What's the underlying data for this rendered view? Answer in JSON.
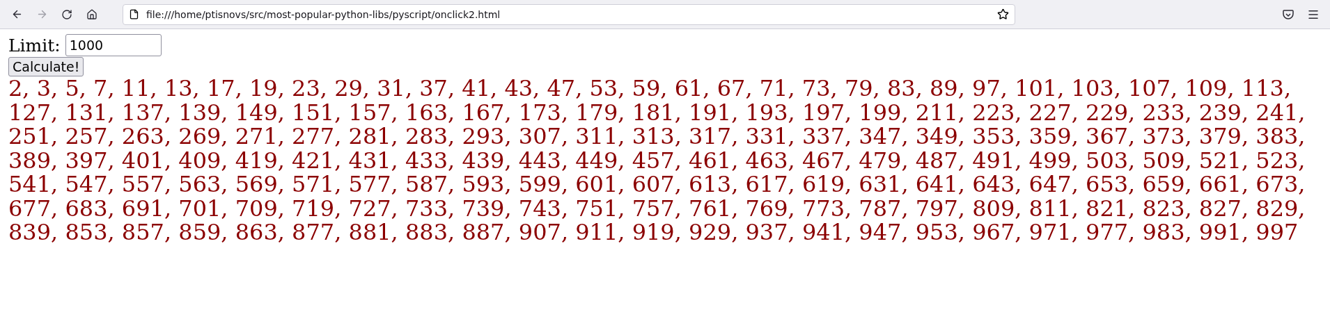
{
  "browser": {
    "back_disabled": false,
    "forward_disabled": true,
    "url": "file:///home/ptisnovs/src/most-popular-python-libs/pyscript/onclick2.html"
  },
  "form": {
    "label": "Limit:",
    "value": "1000",
    "button": "Calculate!"
  },
  "output": "2, 3, 5, 7, 11, 13, 17, 19, 23, 29, 31, 37, 41, 43, 47, 53, 59, 61, 67, 71, 73, 79, 83, 89, 97, 101, 103, 107, 109, 113, 127, 131, 137, 139, 149, 151, 157, 163, 167, 173, 179, 181, 191, 193, 197, 199, 211, 223, 227, 229, 233, 239, 241, 251, 257, 263, 269, 271, 277, 281, 283, 293, 307, 311, 313, 317, 331, 337, 347, 349, 353, 359, 367, 373, 379, 383, 389, 397, 401, 409, 419, 421, 431, 433, 439, 443, 449, 457, 461, 463, 467, 479, 487, 491, 499, 503, 509, 521, 523, 541, 547, 557, 563, 569, 571, 577, 587, 593, 599, 601, 607, 613, 617, 619, 631, 641, 643, 647, 653, 659, 661, 673, 677, 683, 691, 701, 709, 719, 727, 733, 739, 743, 751, 757, 761, 769, 773, 787, 797, 809, 811, 821, 823, 827, 829, 839, 853, 857, 859, 863, 877, 881, 883, 887, 907, 911, 919, 929, 937, 941, 947, 953, 967, 971, 977, 983, 991, 997"
}
